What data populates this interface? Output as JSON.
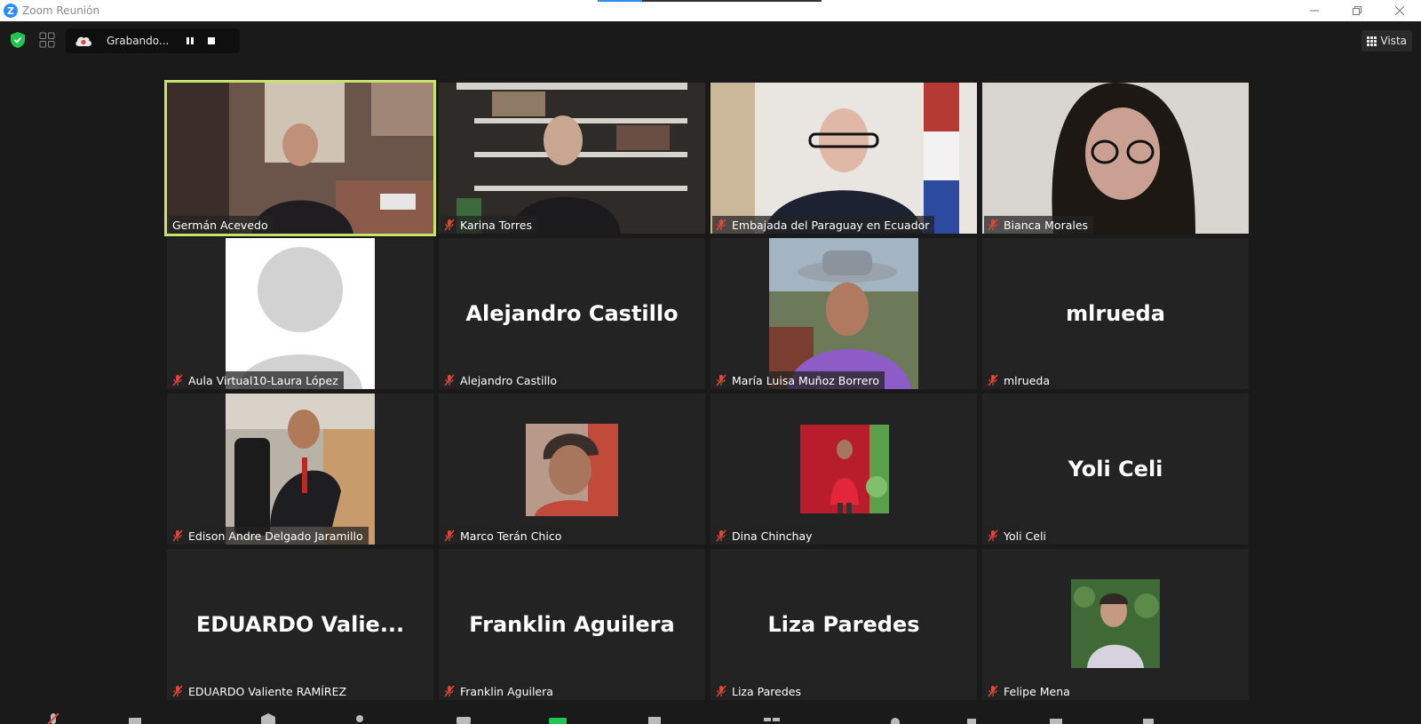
{
  "window": {
    "title": "Zoom Reunión",
    "load_progress": 0.2
  },
  "topbar": {
    "recording_label": "Grabando...",
    "view_label": "Vista"
  },
  "participants": [
    {
      "name": "Germán Acevedo",
      "muted": false,
      "active_speaker": true,
      "tile": "video",
      "video_colors": [
        "#6b5449",
        "#2a2120",
        "#c9b7a6"
      ]
    },
    {
      "name": "Karina Torres",
      "muted": true,
      "tile": "video",
      "video_colors": [
        "#2f2b28",
        "#d6d2cc",
        "#4a3e36"
      ]
    },
    {
      "name": "Embajada del Paraguay en Ecuador",
      "muted": true,
      "tile": "video",
      "video_colors": [
        "#e9e6e2",
        "#1d2233",
        "#b63a34"
      ]
    },
    {
      "name": "Bianca Morales",
      "muted": true,
      "tile": "video",
      "video_colors": [
        "#d9d5d1",
        "#1e1815",
        "#a6857a"
      ]
    },
    {
      "name": "Aula Virtual10-Laura López",
      "muted": true,
      "tile": "avatar-placeholder"
    },
    {
      "name": "Alejandro Castillo",
      "muted": true,
      "tile": "name",
      "display": "Alejandro Castillo"
    },
    {
      "name": "María Luisa Muñoz Borrero",
      "muted": true,
      "tile": "photo",
      "video_colors": [
        "#6d7a5a",
        "#8d5cc6",
        "#a3b5c2"
      ]
    },
    {
      "name": "mlrueda",
      "muted": true,
      "tile": "name",
      "display": "mlrueda"
    },
    {
      "name": "Edison Andre Delgado Jaramillo",
      "muted": true,
      "tile": "photo",
      "video_colors": [
        "#c89b6c",
        "#1b1b1b",
        "#b8b2a8"
      ]
    },
    {
      "name": "Marco Terán Chico",
      "muted": true,
      "tile": "photo",
      "video_colors": [
        "#b79a8a",
        "#3a2e2a",
        "#c14a3a"
      ]
    },
    {
      "name": "Dina Chinchay",
      "muted": true,
      "tile": "photo",
      "video_colors": [
        "#b71d2b",
        "#d9283a",
        "#5aa04a"
      ]
    },
    {
      "name": "Yoli Celi",
      "muted": true,
      "tile": "name",
      "display": "Yoli Celi"
    },
    {
      "name": "EDUARDO Valiente RAMÍREZ",
      "muted": true,
      "tile": "name",
      "display": "EDUARDO  Valie..."
    },
    {
      "name": "Franklin Aguilera",
      "muted": true,
      "tile": "name",
      "display": "Franklin Aguilera"
    },
    {
      "name": "Liza Paredes",
      "muted": true,
      "tile": "name",
      "display": "Liza Paredes"
    },
    {
      "name": "Felipe Mena",
      "muted": true,
      "tile": "photo",
      "video_colors": [
        "#3f6a35",
        "#d6d3de",
        "#2f2a26"
      ]
    }
  ],
  "colors": {
    "background": "#1a1a1a",
    "tile": "#232323",
    "active_speaker_border": "#c8e36a",
    "muted_mic": "#e0453a",
    "shield": "#23c552"
  }
}
